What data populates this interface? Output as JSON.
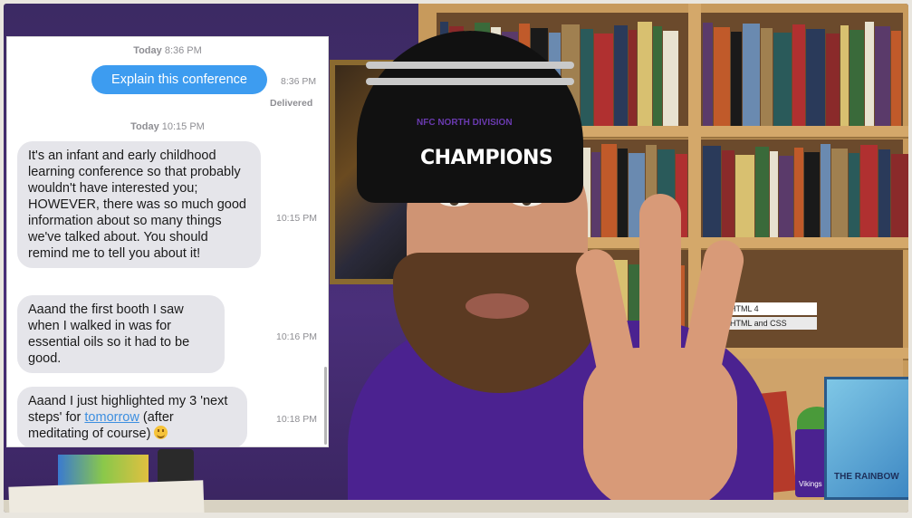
{
  "chat": {
    "ts1_day": "Today",
    "ts1_time": "8:36 PM",
    "out_message": "Explain this conference",
    "out_time": "8:36 PM",
    "delivered": "Delivered",
    "ts2_day": "Today",
    "ts2_time": "10:15 PM",
    "msg1": "It's an infant and early childhood learning conference so that probably wouldn't have interested you; HOWEVER, there was so much good information about so many things we've talked about.  You should remind me to tell you about it!",
    "msg1_time": "10:15 PM",
    "msg2": "Aaand the first booth I saw when I walked in was for essential oils so it had to be good.",
    "msg2_time": "10:16 PM",
    "msg3_before": "Aaand I just highlighted my 3 'next steps' for ",
    "msg3_link": "tomorrow",
    "msg3_after": " (after meditating of course) ",
    "msg3_time": "10:18 PM",
    "emoji_icon": "smiley-emoji-icon"
  },
  "beanie": {
    "sub_text": "NFC NORTH DIVISION",
    "main_text": "CHAMPIONS"
  },
  "decor": {
    "poster_text": "THE RAINBOW",
    "cup_text": "Vikings",
    "book_spine_1": "HTML 4",
    "book_spine_2": "HTML and CSS"
  },
  "colors": {
    "outgoing_bubble": "#3d9cf0",
    "incoming_bubble": "#e5e5ea",
    "link": "#3d8fe0",
    "shirt_purple": "#4b2290"
  }
}
